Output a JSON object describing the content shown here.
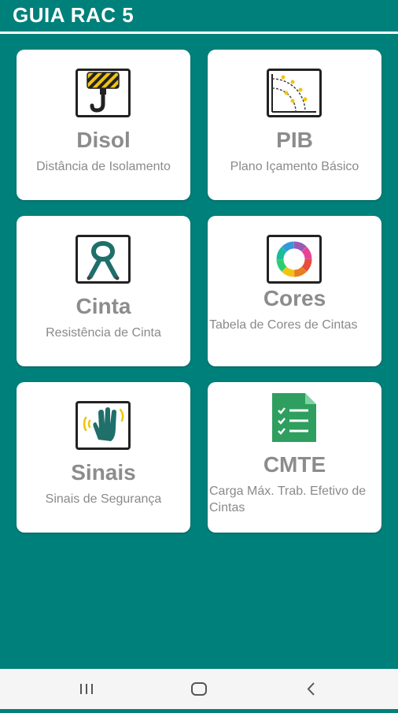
{
  "app": {
    "title": "GUIA RAC 5"
  },
  "cards": [
    {
      "name": "Disol",
      "desc": "Distância de Isolamento",
      "icon": "crane-hook-icon"
    },
    {
      "name": "PIB",
      "desc": "Plano Içamento Básico",
      "icon": "lifting-radius-icon"
    },
    {
      "name": "Cinta",
      "desc": "Resistência de Cinta",
      "icon": "sling-icon"
    },
    {
      "name": "Cores",
      "desc": "Tabela de Cores de Cintas",
      "icon": "color-wheel-icon"
    },
    {
      "name": "Sinais",
      "desc": "Sinais de Segurança",
      "icon": "hand-signal-icon"
    },
    {
      "name": "CMTE",
      "desc": "Carga Máx. Trab. Efetivo de Cintas",
      "icon": "checklist-document-icon"
    }
  ],
  "navbar": {
    "buttons": [
      "recent-apps-icon",
      "home-icon",
      "back-icon"
    ]
  },
  "colors": {
    "background": "#00807a",
    "card": "#ffffff",
    "text": "#8c8c8c",
    "icon_green": "#2e9f5e"
  }
}
